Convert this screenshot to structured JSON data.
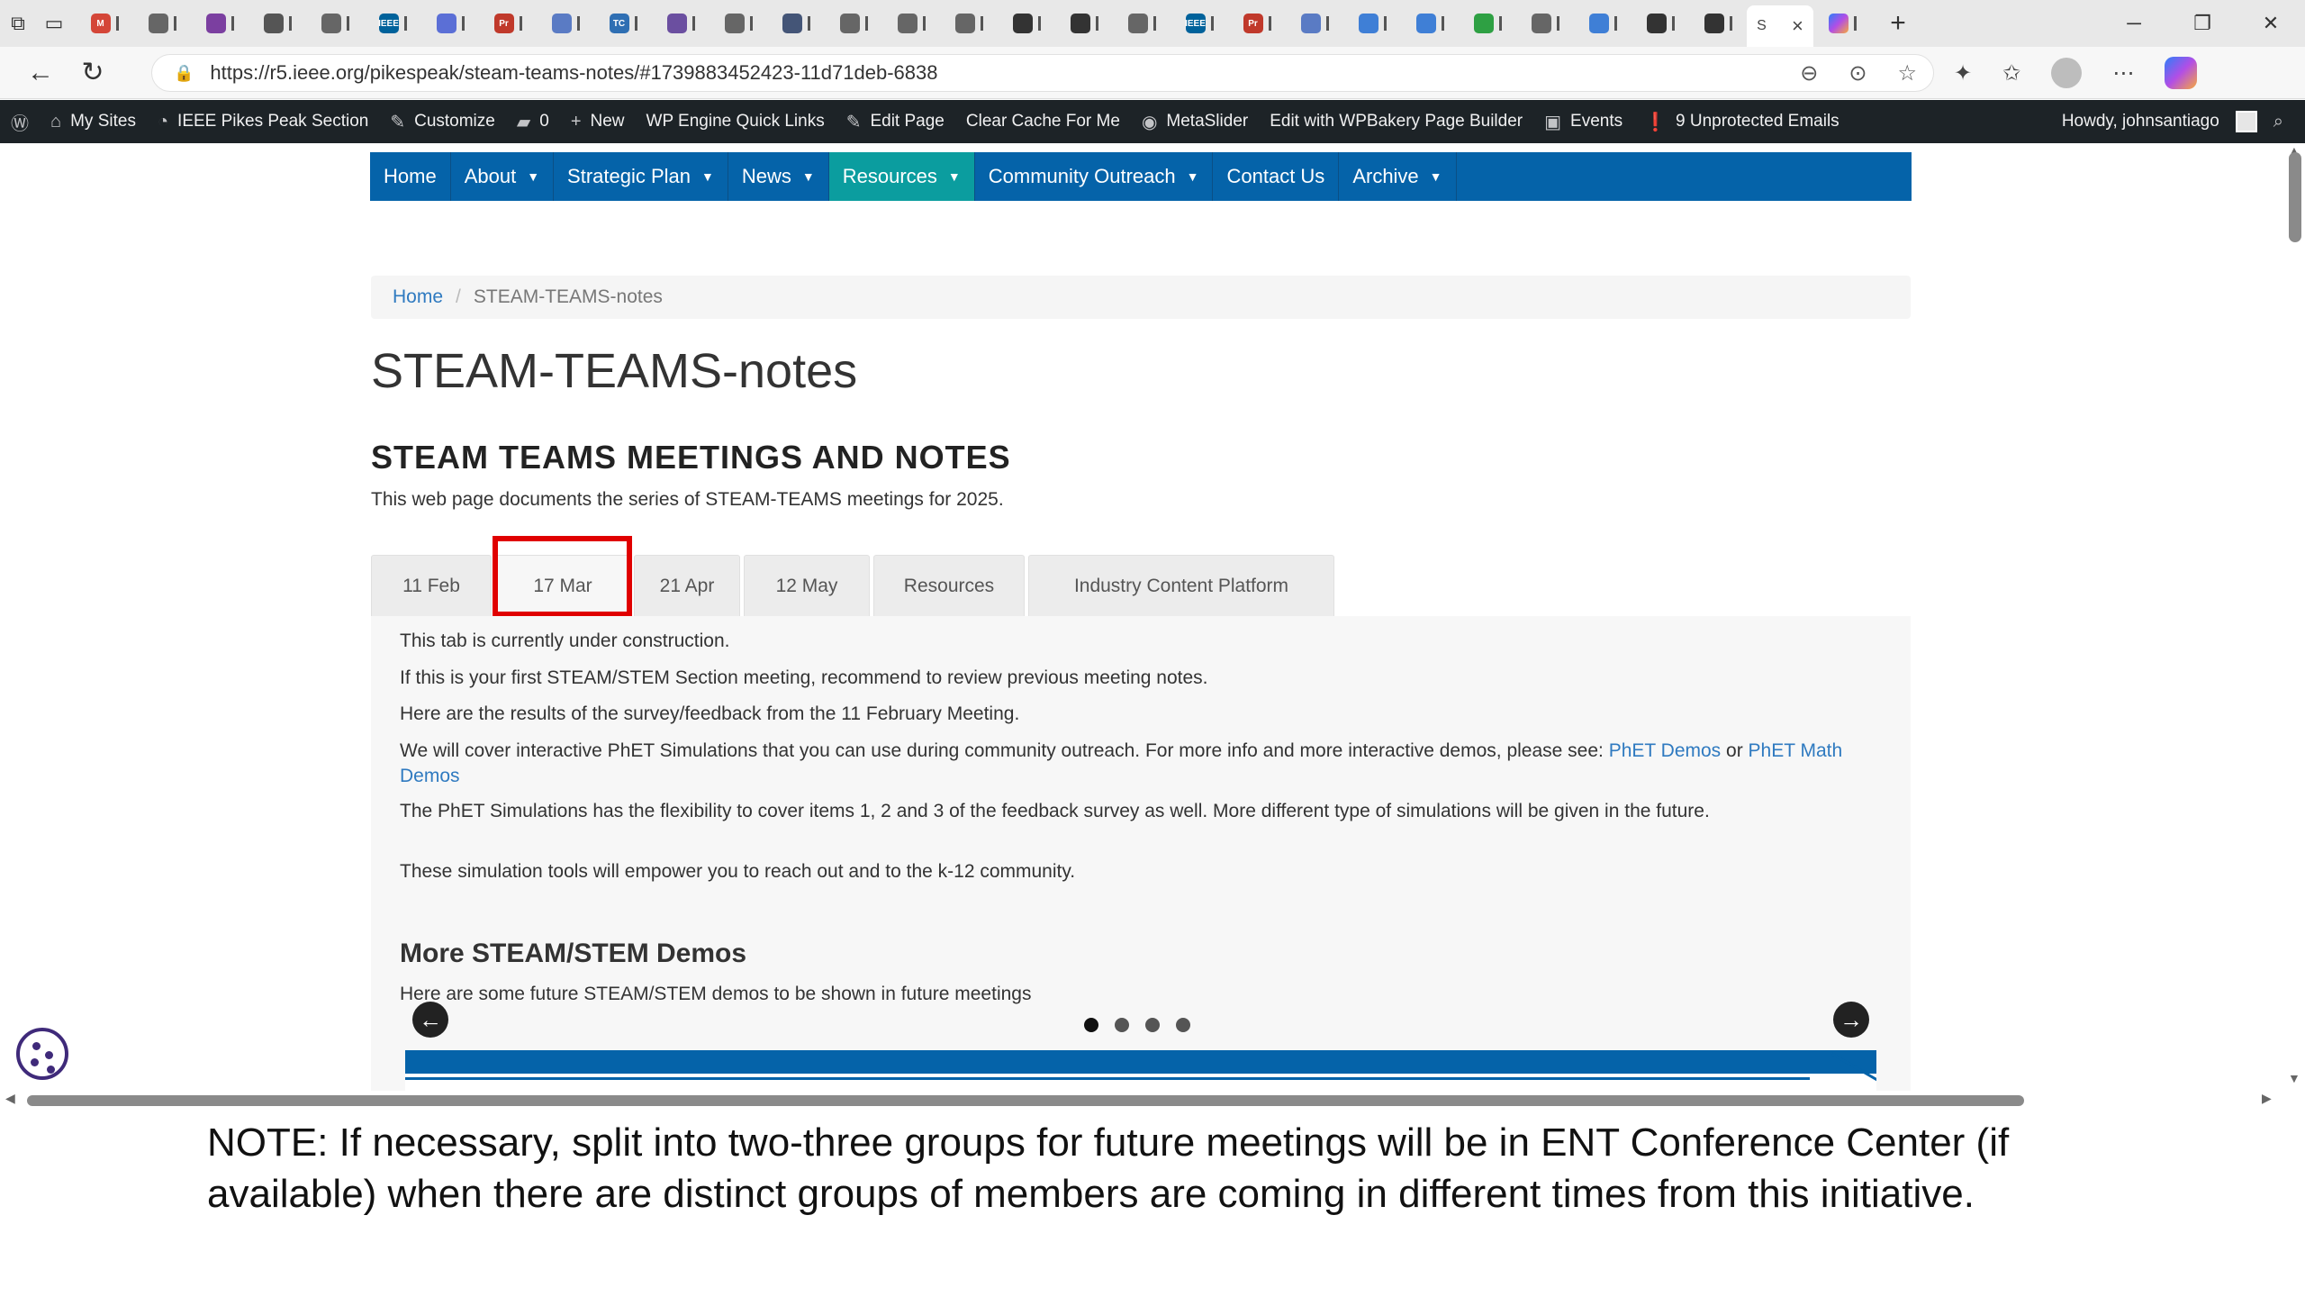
{
  "browser": {
    "tabs": [
      {
        "letter": "M",
        "color": "#d44638"
      },
      {
        "letter": "",
        "color": "#666666"
      },
      {
        "letter": "",
        "color": "#7b3fa0"
      },
      {
        "letter": "",
        "color": "#555555"
      },
      {
        "letter": "",
        "color": "#666666"
      },
      {
        "letter": "IEEE",
        "color": "#00629b"
      },
      {
        "letter": "",
        "color": "#5b6fd6"
      },
      {
        "letter": "Pr",
        "color": "#c0392b"
      },
      {
        "letter": "",
        "color": "#5a7bc4"
      },
      {
        "letter": "TC",
        "color": "#2f6fb3"
      },
      {
        "letter": "",
        "color": "#6b4fa0"
      },
      {
        "letter": "",
        "color": "#666666"
      },
      {
        "letter": "",
        "color": "#445577"
      },
      {
        "letter": "",
        "color": "#666666"
      },
      {
        "letter": "",
        "color": "#666666"
      },
      {
        "letter": "",
        "color": "#666666"
      },
      {
        "letter": "",
        "color": "#333333"
      },
      {
        "letter": "",
        "color": "#333333"
      },
      {
        "letter": "",
        "color": "#666666"
      },
      {
        "letter": "IEEE",
        "color": "#00629b"
      },
      {
        "letter": "Pr",
        "color": "#c0392b"
      },
      {
        "letter": "",
        "color": "#5a7bc4"
      },
      {
        "letter": "",
        "color": "#3f7fd6"
      },
      {
        "letter": "",
        "color": "#3f7fd6"
      },
      {
        "letter": "",
        "color": "#2ea043"
      },
      {
        "letter": "",
        "color": "#666666"
      },
      {
        "letter": "",
        "color": "#3f7fd6"
      },
      {
        "letter": "",
        "color": "#333333"
      },
      {
        "letter": "",
        "color": "#333333"
      }
    ],
    "active_tab": {
      "label": "S",
      "close": "×"
    },
    "url": "https://r5.ieee.org/pikespeak/steam-teams-notes/#1739883452423-11d71deb-6838"
  },
  "adminbar": {
    "items": [
      "My Sites",
      "IEEE Pikes Peak Section",
      "Customize",
      "0",
      "New",
      "WP Engine Quick Links",
      "Edit Page",
      "Clear Cache For Me",
      "MetaSlider",
      "Edit with WPBakery Page Builder",
      "Events",
      "9 Unprotected Emails"
    ],
    "howdy": "Howdy, johnsantiago"
  },
  "sitenav": {
    "items": [
      {
        "label": "Home",
        "caret": false
      },
      {
        "label": "About",
        "caret": true
      },
      {
        "label": "Strategic Plan",
        "caret": true
      },
      {
        "label": "News",
        "caret": true
      },
      {
        "label": "Resources",
        "caret": true
      },
      {
        "label": "Community Outreach",
        "caret": true
      },
      {
        "label": "Contact Us",
        "caret": false
      },
      {
        "label": "Archive",
        "caret": true
      }
    ]
  },
  "breadcrumb": {
    "home": "Home",
    "separator": "/",
    "current": "STEAM-TEAMS-notes"
  },
  "page": {
    "title": "STEAM-TEAMS-notes",
    "heading": "STEAM TEAMS MEETINGS AND NOTES",
    "intro": "This web page documents the series of STEAM-TEAMS meetings for 2025."
  },
  "tabs": [
    "11 Feb",
    "17 Mar",
    "21 Apr",
    "12 May",
    "Resources",
    "Industry Content Platform"
  ],
  "panel": {
    "p1": "This tab is currently under construction.",
    "p2": "If this is your first STEAM/STEM Section meeting, recommend to review previous meeting notes.",
    "p3": "Here are the results of the survey/feedback from the 11 February Meeting.",
    "p4_text": "We will cover interactive PhET Simulations that you can use during community outreach. For more info and more interactive demos, please see: ",
    "p4_link1": "PhET Demos",
    "p4_or": " or ",
    "p4_link2": "PhET Math Demos",
    "p5": "The PhET Simulations has the flexibility to cover items 1, 2 and 3 of the feedback survey as well.  More different type of simulations will be given in the future.",
    "p6": "These simulation tools will empower you to reach out and to the k-12 community.",
    "demos_heading": "More STEAM/STEM Demos",
    "demos_text": "Here are some future  STEAM/STEM demos to be shown in future meetings"
  },
  "note": "NOTE:  If necessary, split into two-three groups for future meetings will be in ENT Conference Center (if available) when there are distinct groups of  members are coming in different times from this initiative."
}
